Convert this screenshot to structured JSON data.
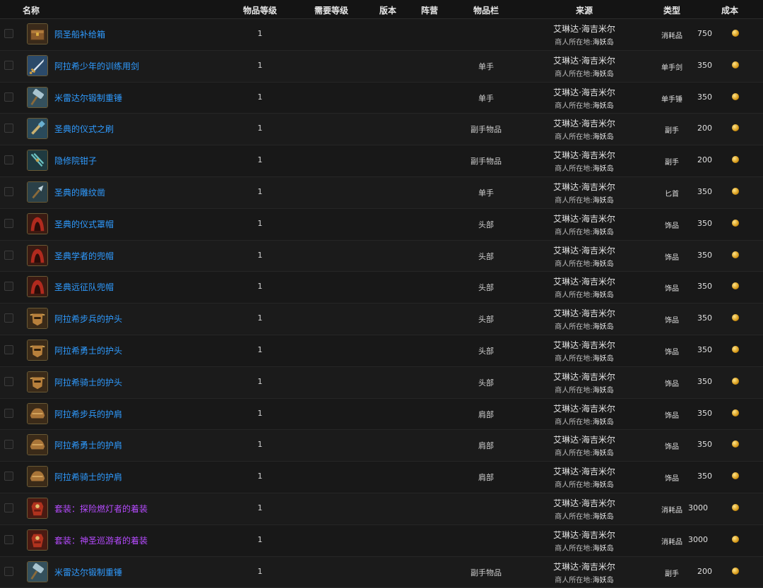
{
  "columns": {
    "name": "名称",
    "item_level": "物品等级",
    "required_level": "需要等级",
    "version": "版本",
    "faction": "阵营",
    "slot": "物品栏",
    "source": "来源",
    "type": "类型",
    "cost": "成本"
  },
  "source_common": {
    "vendor_name": "艾琳达·海吉米尔",
    "location_label": "商人所在地:",
    "location_zone": "海妖岛"
  },
  "rows": [
    {
      "name": "陨圣船补给箱",
      "ilvl": "1",
      "slot": "",
      "type": "消耗品",
      "cost": "750",
      "icon": "chest-icon",
      "color": "blue"
    },
    {
      "name": "阿拉希少年的训练用剑",
      "ilvl": "1",
      "slot": "单手",
      "type": "单手剑",
      "cost": "350",
      "icon": "sword-icon",
      "color": "blue"
    },
    {
      "name": "米雷达尔锻制重锤",
      "ilvl": "1",
      "slot": "单手",
      "type": "单手锤",
      "cost": "350",
      "icon": "hammer-icon",
      "color": "blue"
    },
    {
      "name": "圣典的仪式之刷",
      "ilvl": "1",
      "slot": "副手物品",
      "type": "副手",
      "cost": "200",
      "icon": "brush-icon",
      "color": "blue"
    },
    {
      "name": "隐修院钳子",
      "ilvl": "1",
      "slot": "副手物品",
      "type": "副手",
      "cost": "200",
      "icon": "tongs-icon",
      "color": "blue"
    },
    {
      "name": "圣典的雕纹凿",
      "ilvl": "1",
      "slot": "单手",
      "type": "匕首",
      "cost": "350",
      "icon": "chisel-icon",
      "color": "blue"
    },
    {
      "name": "圣典的仪式罩帽",
      "ilvl": "1",
      "slot": "头部",
      "type": "饰品",
      "cost": "350",
      "icon": "hood-icon",
      "color": "blue"
    },
    {
      "name": "圣典学者的兜帽",
      "ilvl": "1",
      "slot": "头部",
      "type": "饰品",
      "cost": "350",
      "icon": "hood-icon",
      "color": "blue"
    },
    {
      "name": "圣典远征队兜帽",
      "ilvl": "1",
      "slot": "头部",
      "type": "饰品",
      "cost": "350",
      "icon": "hood-icon",
      "color": "blue"
    },
    {
      "name": "阿拉希步兵的护头",
      "ilvl": "1",
      "slot": "头部",
      "type": "饰品",
      "cost": "350",
      "icon": "helm-icon",
      "color": "blue"
    },
    {
      "name": "阿拉希勇士的护头",
      "ilvl": "1",
      "slot": "头部",
      "type": "饰品",
      "cost": "350",
      "icon": "helm-icon",
      "color": "blue"
    },
    {
      "name": "阿拉希骑士的护头",
      "ilvl": "1",
      "slot": "头部",
      "type": "饰品",
      "cost": "350",
      "icon": "helm-icon",
      "color": "blue"
    },
    {
      "name": "阿拉希步兵的护肩",
      "ilvl": "1",
      "slot": "肩部",
      "type": "饰品",
      "cost": "350",
      "icon": "shoulder-icon",
      "color": "blue"
    },
    {
      "name": "阿拉希勇士的护肩",
      "ilvl": "1",
      "slot": "肩部",
      "type": "饰品",
      "cost": "350",
      "icon": "shoulder-icon",
      "color": "blue"
    },
    {
      "name": "阿拉希骑士的护肩",
      "ilvl": "1",
      "slot": "肩部",
      "type": "饰品",
      "cost": "350",
      "icon": "shoulder-icon",
      "color": "blue"
    },
    {
      "name": "套装：探险燃灯者的着装",
      "ilvl": "1",
      "slot": "",
      "type": "消耗品",
      "cost": "3000",
      "icon": "ensemble-icon",
      "color": "purple"
    },
    {
      "name": "套装：神圣巡游者的着装",
      "ilvl": "1",
      "slot": "",
      "type": "消耗品",
      "cost": "3000",
      "icon": "ensemble-icon",
      "color": "purple"
    },
    {
      "name": "米雷达尔锻制重锤",
      "ilvl": "1",
      "slot": "副手物品",
      "type": "副手",
      "cost": "200",
      "icon": "hammer-icon",
      "color": "blue"
    }
  ],
  "colors": {
    "link_blue": "#2f9bff",
    "epic_purple": "#b64bff",
    "background": "#141414"
  },
  "currency_icon": "gold-coin-icon"
}
